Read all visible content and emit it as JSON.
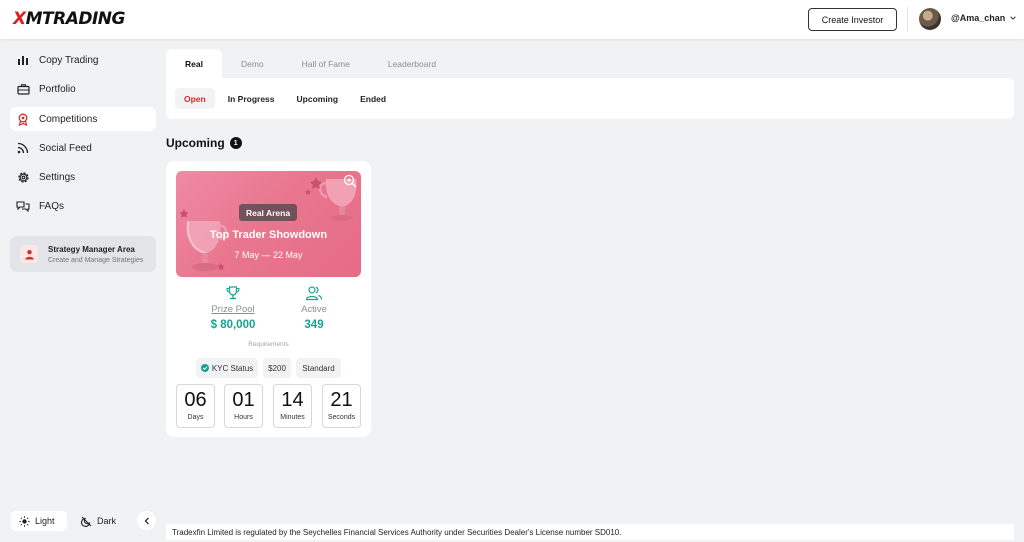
{
  "header": {
    "logo": "XMTRADING",
    "create_investor": "Create Investor",
    "username": "@Ama_chan"
  },
  "sidebar": {
    "items": [
      {
        "label": "Copy Trading",
        "icon": "bar-chart-icon"
      },
      {
        "label": "Portfolio",
        "icon": "briefcase-icon"
      },
      {
        "label": "Competitions",
        "icon": "award-icon",
        "active": true
      },
      {
        "label": "Social Feed",
        "icon": "rss-icon"
      },
      {
        "label": "Settings",
        "icon": "gear-icon"
      },
      {
        "label": "FAQs",
        "icon": "chat-icon"
      }
    ],
    "strategy": {
      "title": "Strategy Manager Area",
      "subtitle": "Create and Manage Strategies"
    },
    "theme": {
      "light": "Light",
      "dark": "Dark"
    }
  },
  "tabs": [
    {
      "label": "Real",
      "active": true
    },
    {
      "label": "Demo"
    },
    {
      "label": "Hall of Fame"
    },
    {
      "label": "Leaderboard"
    }
  ],
  "subtabs": [
    {
      "label": "Open",
      "active": true
    },
    {
      "label": "In Progress"
    },
    {
      "label": "Upcoming"
    },
    {
      "label": "Ended"
    }
  ],
  "section": {
    "title": "Upcoming",
    "count": "1"
  },
  "competition": {
    "badge": "Real Arena",
    "title": "Top Trader Showdown",
    "dates": "7 May  —  22 May",
    "prize_label": "Prize Pool",
    "prize_value": "$ 80,000",
    "active_label": "Active",
    "active_value": "349",
    "requirements_label": "Requirements",
    "requirements": [
      "KYC Status",
      "$200",
      "Standard"
    ],
    "countdown": [
      {
        "value": "06",
        "unit": "Days"
      },
      {
        "value": "01",
        "unit": "Hours"
      },
      {
        "value": "14",
        "unit": "Minutes"
      },
      {
        "value": "21",
        "unit": "Seconds"
      }
    ]
  },
  "footer": {
    "text": "Tradexfin Limited is regulated by the Seychelles Financial Services Authority under Securities Dealer's License number SD010."
  },
  "colors": {
    "accent_red": "#d42a2a",
    "teal": "#17a394",
    "banner_pink": "#eb7c95"
  }
}
